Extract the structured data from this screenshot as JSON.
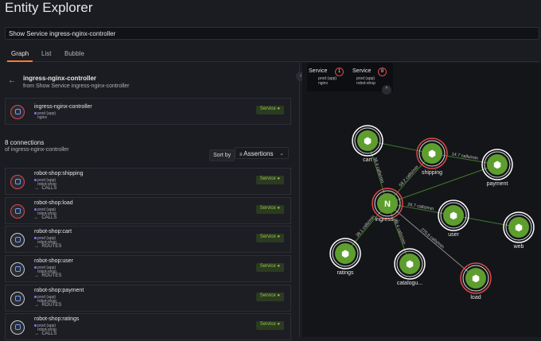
{
  "app": {
    "title": "Entity Explorer"
  },
  "query": {
    "value": "Show Service ingress-nginx-controller"
  },
  "tabs": [
    {
      "label": "Graph"
    },
    {
      "label": "List"
    },
    {
      "label": "Bubble"
    }
  ],
  "entity": {
    "name": "ingress-nginx-controller",
    "from": "from Show Service ingress-nginx-controller",
    "card": {
      "name": "ingress-nginx-controller",
      "tag1": "prod (app)",
      "tag2": "nginx",
      "badge": "Service"
    }
  },
  "connections": {
    "count_label": "8 connections",
    "of_label": "of ingress-nginx-controller",
    "sort_label": "Sort by",
    "sort_value": "Assertions",
    "items": [
      {
        "name": "robot-shop:shipping",
        "tag1": "prod (app)",
        "tag2": "robot-shop",
        "rel": "CALLS",
        "arrow": "→",
        "badge": "Service",
        "ring": "#e04848"
      },
      {
        "name": "robot-shop:load",
        "tag1": "prod (app)",
        "tag2": "robot-shop",
        "rel": "CALLS",
        "arrow": "←",
        "badge": "Service",
        "ring": "#e04848"
      },
      {
        "name": "robot-shop:cart",
        "tag1": "prod (app)",
        "tag2": "robot-shop",
        "rel": "ROUTES",
        "arrow": "→",
        "badge": "Service",
        "ring": "#cccccc"
      },
      {
        "name": "robot-shop:user",
        "tag1": "prod (app)",
        "tag2": "robot-shop",
        "rel": "ROUTES",
        "arrow": "→",
        "badge": "Service",
        "ring": "#cccccc"
      },
      {
        "name": "robot-shop:payment",
        "tag1": "prod (app)",
        "tag2": "robot-shop",
        "rel": "ROUTES",
        "arrow": "→",
        "badge": "Service",
        "ring": "#cccccc"
      },
      {
        "name": "robot-shop:ratings",
        "tag1": "prod (app)",
        "tag2": "robot-shop",
        "rel": "CALLS",
        "arrow": "→",
        "badge": "Service",
        "ring": "#cccccc"
      }
    ]
  },
  "graph_header": {
    "left": {
      "label": "Service",
      "count": "1",
      "sub1": "prod (app)",
      "sub2": "nginx"
    },
    "right": {
      "label": "Service",
      "count": "8",
      "sub1": "prod (app)",
      "sub2": "robot-shop"
    }
  },
  "graph": {
    "nodes": [
      {
        "id": "cart",
        "label": "cart",
        "ring": "#ffffff",
        "icon": "hex-icon"
      },
      {
        "id": "shipping",
        "label": "shipping",
        "ring": "#e04848",
        "icon": "hex-icon"
      },
      {
        "id": "payment",
        "label": "payment",
        "ring": "#ffffff",
        "icon": "hex-icon"
      },
      {
        "id": "ingress",
        "label": "ingress-...",
        "ring": "#e04848",
        "icon": "nginx-icon"
      },
      {
        "id": "user",
        "label": "user",
        "ring": "#ffffff",
        "icon": "hex-icon"
      },
      {
        "id": "web",
        "label": "web",
        "ring": "#ffffff",
        "icon": "hex-icon"
      },
      {
        "id": "ratings",
        "label": "ratings",
        "ring": "#ffffff",
        "icon": "hex-icon"
      },
      {
        "id": "catalogue",
        "label": "catalogu...",
        "ring": "#ffffff",
        "icon": "hex-icon"
      },
      {
        "id": "load",
        "label": "load",
        "ring": "#e04848",
        "icon": "hex-icon"
      }
    ],
    "edges": [
      {
        "from": "ingress",
        "to": "cart",
        "label": "38.4 calls/min"
      },
      {
        "from": "ingress",
        "to": "shipping",
        "label": "58.2 calls/min"
      },
      {
        "from": "ingress",
        "to": "user",
        "label": "26.7 calls/min"
      },
      {
        "from": "ingress",
        "to": "ratings",
        "label": "38.1 calls/min"
      },
      {
        "from": "ingress",
        "to": "catalogue",
        "label": "98.4 calls/min"
      },
      {
        "from": "ingress",
        "to": "load",
        "label": "270.6 calls/min"
      },
      {
        "from": "shipping",
        "to": "payment",
        "label": "14.7 calls/min"
      },
      {
        "from": "cart",
        "to": "shipping",
        "label": ""
      },
      {
        "from": "user",
        "to": "web",
        "label": ""
      },
      {
        "from": "payment",
        "to": "ingress",
        "label": ""
      }
    ]
  },
  "colors": {
    "node_fill": "#5e9e2e",
    "accent": "#ff7a2f",
    "badge_text": "#8ec04a",
    "alert": "#e04848"
  }
}
